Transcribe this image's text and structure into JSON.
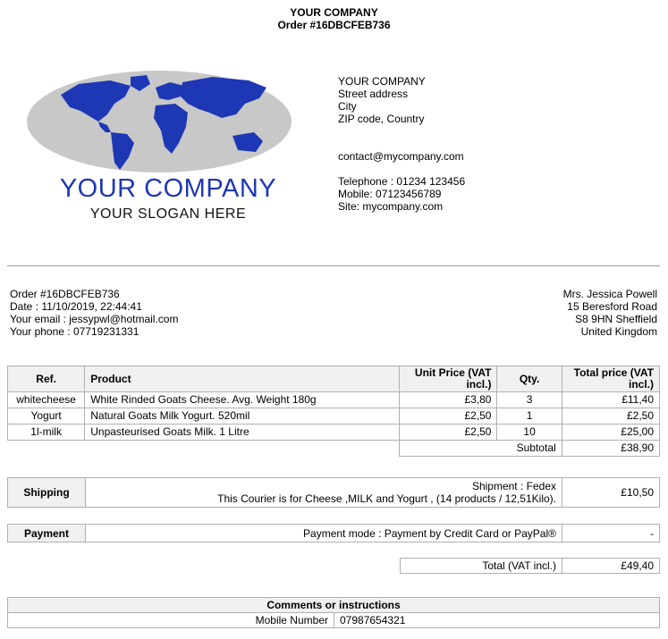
{
  "header": {
    "company": "YOUR COMPANY",
    "order": "Order #16DBCFEB736"
  },
  "logo": {
    "name": "YOUR COMPANY",
    "slogan": "YOUR SLOGAN HERE"
  },
  "company_address": {
    "name": "YOUR COMPANY",
    "street": "Street address",
    "city": "City",
    "zip": "ZIP code, Country",
    "email": "contact@mycompany.com",
    "telephone": "Telephone : 01234 123456",
    "mobile": "Mobile: 07123456789",
    "site": "Site: mycompany.com"
  },
  "order_info": {
    "order": "Order #16DBCFEB736",
    "date": "Date : 11/10/2019, 22:44:41",
    "email": "Your email : jessypwl@hotmail.com",
    "phone": "Your phone : 07719231331"
  },
  "ship_to": {
    "name": "Mrs. Jessica Powell",
    "street": "15 Beresford Road",
    "city": "S8 9HN Sheffield",
    "country": "United Kingdom"
  },
  "products": {
    "headers": {
      "ref": "Ref.",
      "product": "Product",
      "unit": "Unit Price (VAT incl.)",
      "qty": "Qty.",
      "total": "Total price (VAT incl.)"
    },
    "rows": [
      {
        "ref": "whitecheese",
        "product": "White Rinded Goats Cheese. Avg. Weight 180g",
        "unit": "£3,80",
        "qty": "3",
        "total": "£11,40"
      },
      {
        "ref": "Yogurt",
        "product": "Natural Goats Milk Yogurt. 520mil",
        "unit": "£2,50",
        "qty": "1",
        "total": "£2,50"
      },
      {
        "ref": "1l-milk",
        "product": "Unpasteurised Goats Milk. 1 Litre",
        "unit": "£2,50",
        "qty": "10",
        "total": "£25,00"
      }
    ],
    "subtotal_label": "Subtotal",
    "subtotal": "£38,90"
  },
  "shipping": {
    "label": "Shipping",
    "line1": "Shipment : Fedex",
    "line2": "This Courier is for Cheese ,MILK and Yogurt , (14 products / 12,51Kilo).",
    "price": "£10,50"
  },
  "payment": {
    "label": "Payment",
    "mode": "Payment mode : Payment by Credit Card or PayPal®",
    "price": "-"
  },
  "total": {
    "label": "Total (VAT incl.)",
    "value": "£49,40"
  },
  "comments": {
    "title": "Comments or instructions",
    "field_label": "Mobile Number",
    "field_value": "07987654321"
  },
  "colors": {
    "logo_blue": "#1e37b4",
    "globe_gray": "#c8c8c8",
    "header_bg": "#f0f0f0"
  }
}
